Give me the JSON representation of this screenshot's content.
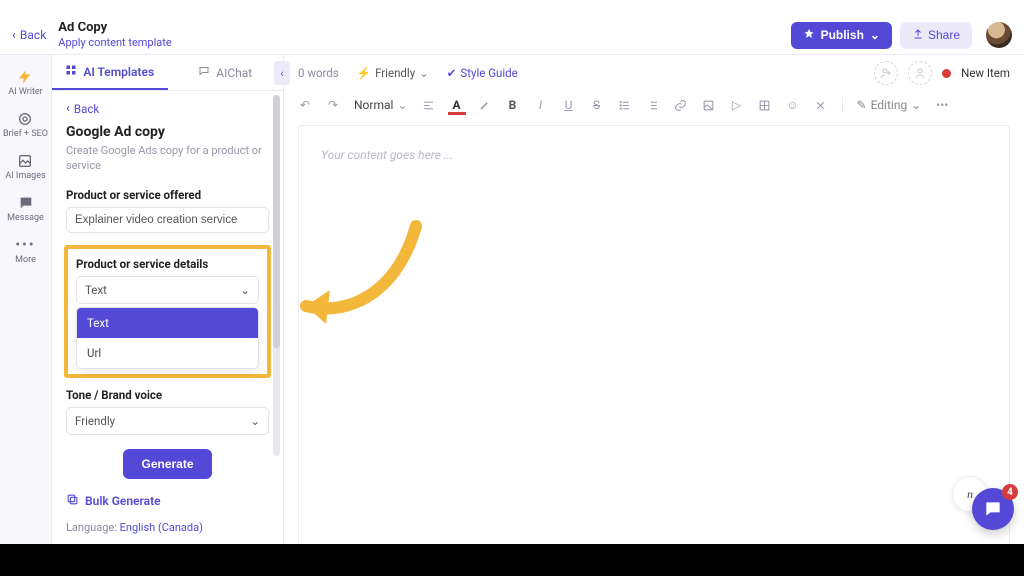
{
  "header": {
    "back": "Back",
    "title": "Ad Copy",
    "apply": "Apply content template",
    "publish": "Publish",
    "share": "Share"
  },
  "rail": {
    "items": [
      "AI Writer",
      "Brief + SEO",
      "AI Images",
      "Message",
      "More"
    ]
  },
  "pane": {
    "tabs": {
      "templates": "AI Templates",
      "chat": "AIChat"
    },
    "back": "Back",
    "title": "Google Ad copy",
    "subtitle": "Create Google Ads copy for a product or service",
    "field_product_label": "Product or service offered",
    "field_product_value": "Explainer video creation service",
    "field_details_label": "Product or service details",
    "field_details_value": "Text",
    "details_options": [
      "Text",
      "Url"
    ],
    "tone_label": "Tone / Brand voice",
    "tone_value": "Friendly",
    "generate": "Generate",
    "bulk": "Bulk Generate",
    "language_label": "Language:",
    "language_value": "English (Canada)"
  },
  "editor": {
    "word_count": "0 words",
    "friendly": "Friendly",
    "style_guide": "Style Guide",
    "new_item": "New Item",
    "normal": "Normal",
    "editing": "Editing",
    "placeholder": "Your content goes here ..."
  },
  "chat_badge": "4"
}
